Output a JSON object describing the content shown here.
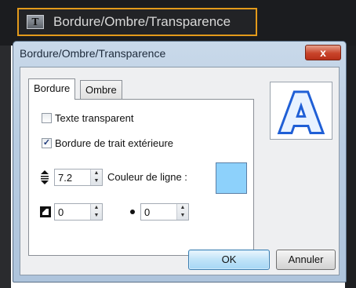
{
  "taskbar": {
    "icon_letter": "T",
    "title": "Bordure/Ombre/Transparence"
  },
  "dialog": {
    "title": "Bordure/Ombre/Transparence",
    "close_glyph": "x",
    "tabs": [
      {
        "label": "Bordure",
        "active": true
      },
      {
        "label": "Ombre",
        "active": false
      }
    ],
    "checkbox_transparent": {
      "label": "Texte transparent",
      "checked": false
    },
    "checkbox_outer_border": {
      "label": "Bordure de trait extérieure",
      "checked": true
    },
    "line_width": {
      "value": "7.2"
    },
    "line_color": {
      "label": "Couleur de ligne :",
      "color": "#8dd1fb"
    },
    "corner_value": {
      "value": "0"
    },
    "dot_value": {
      "value": "0"
    },
    "preview_letter": "A",
    "ok_label": "OK",
    "cancel_label": "Annuler"
  }
}
